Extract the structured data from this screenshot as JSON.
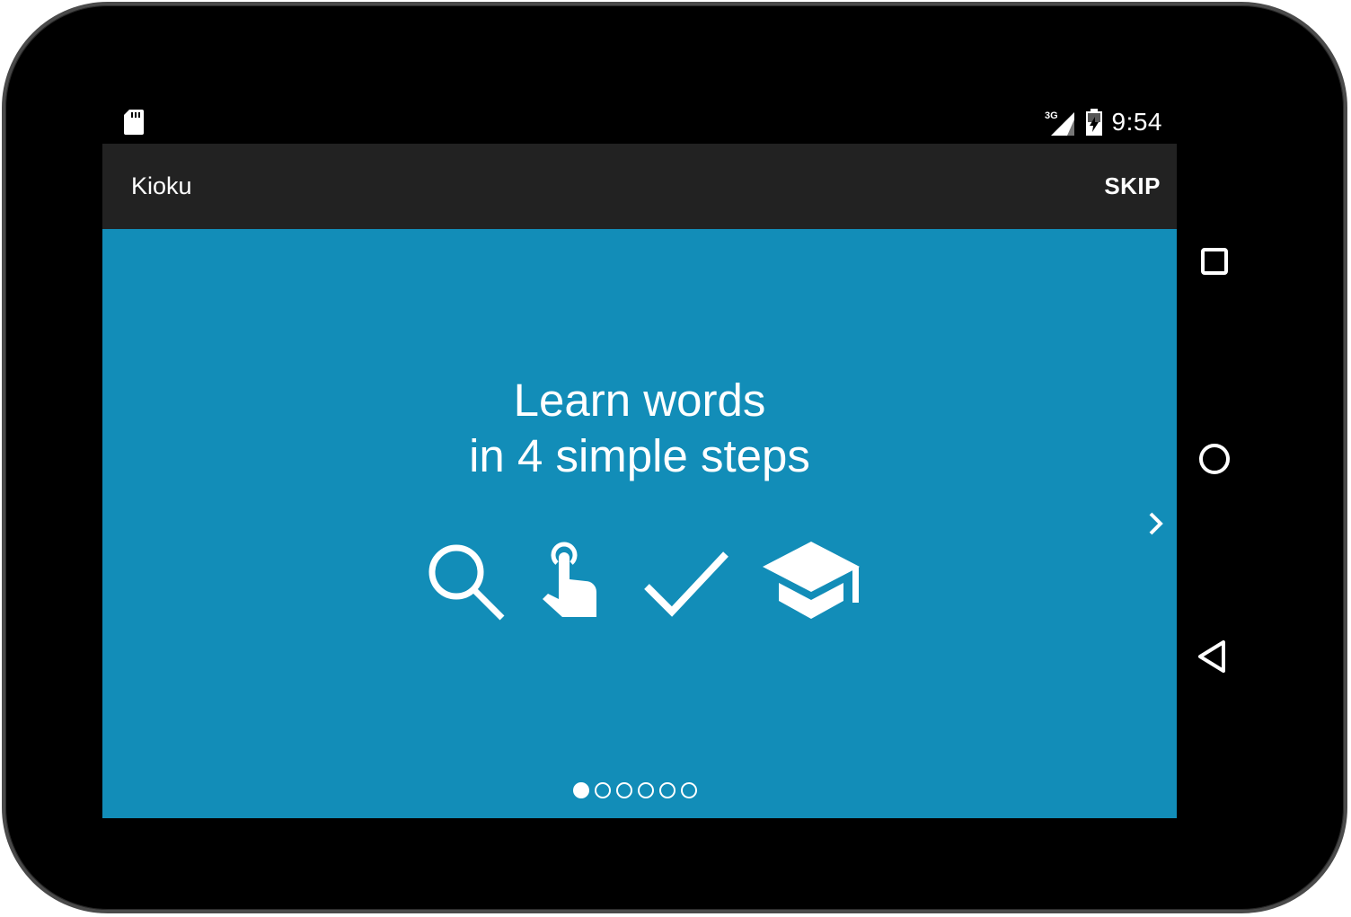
{
  "status_bar": {
    "icons": [
      "sd-card-icon",
      "signal-3g-icon",
      "battery-charging-icon"
    ],
    "network_label": "3G",
    "time": "9:54"
  },
  "toolbar": {
    "title": "Kioku",
    "skip_label": "SKIP"
  },
  "onboarding": {
    "headline_line1": "Learn words",
    "headline_line2": "in 4 simple steps",
    "step_icons": [
      "search-icon",
      "touch-icon",
      "check-icon",
      "graduation-cap-icon"
    ],
    "page_count": 6,
    "current_page": 1
  },
  "navigation_bar": {
    "buttons": [
      "recents-button",
      "home-button",
      "back-button"
    ]
  },
  "colors": {
    "content_bg": "#128db8",
    "toolbar_bg": "#222222",
    "device_frame": "#000000"
  }
}
